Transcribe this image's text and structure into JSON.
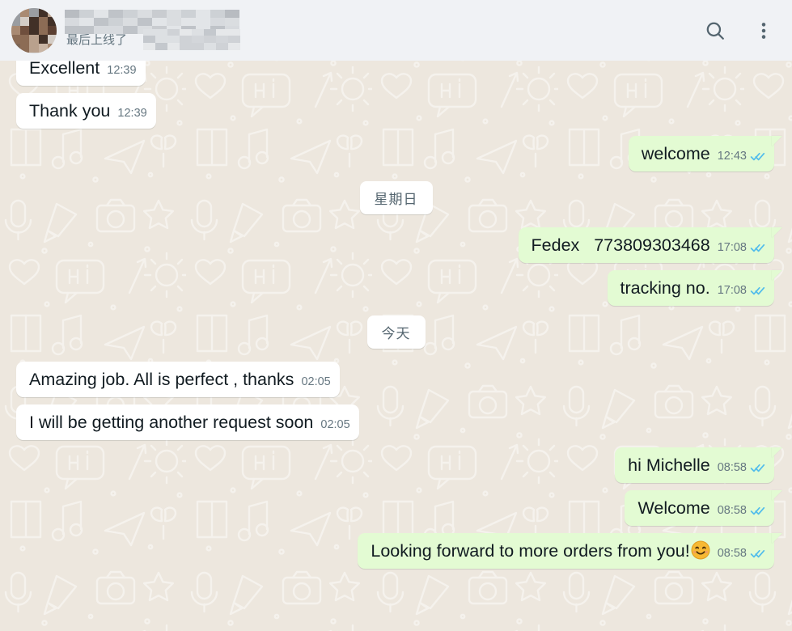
{
  "header": {
    "contact_name": "",
    "contact_name_redacted": true,
    "status_text": "最后上线了",
    "status_redacted": true,
    "avatar_redacted": true,
    "avatar_name": "contact-avatar",
    "search_icon": "search-icon",
    "menu_icon": "overflow-menu-icon"
  },
  "colors": {
    "header_bg": "#F0F2F5",
    "chat_bg": "#EDE7DE",
    "incoming_bubble": "#FFFFFF",
    "outgoing_bubble": "#E3FBD3",
    "tick_read": "#53BDEB",
    "meta_text": "#667781",
    "msg_text": "#111B21",
    "icon": "#54656F"
  },
  "conversation": [
    {
      "kind": "message",
      "direction": "in",
      "text": "Excellent",
      "time": "12:39",
      "status": "none",
      "clipped_top": true
    },
    {
      "kind": "message",
      "direction": "in",
      "text": "Thank you",
      "time": "12:39",
      "status": "none"
    },
    {
      "kind": "message",
      "direction": "out",
      "text": "welcome",
      "time": "12:43",
      "status": "read"
    },
    {
      "kind": "divider",
      "label": "星期日"
    },
    {
      "kind": "message",
      "direction": "out",
      "text": "Fedex   773809303468",
      "time": "17:08",
      "status": "read"
    },
    {
      "kind": "message",
      "direction": "out",
      "text": "tracking no.",
      "time": "17:08",
      "status": "read"
    },
    {
      "kind": "divider",
      "label": "今天"
    },
    {
      "kind": "message",
      "direction": "in",
      "text": "Amazing job. All is perfect , thanks",
      "time": "02:05",
      "status": "none"
    },
    {
      "kind": "message",
      "direction": "in",
      "text": "I will be getting another request soon",
      "time": "02:05",
      "status": "none"
    },
    {
      "kind": "message",
      "direction": "out",
      "text": "hi Michelle",
      "time": "08:58",
      "status": "read"
    },
    {
      "kind": "message",
      "direction": "out",
      "text": "Welcome",
      "time": "08:58",
      "status": "read"
    },
    {
      "kind": "message",
      "direction": "out",
      "text": "Looking forward to more orders from you!",
      "emoji": "😊",
      "emoji_name": "smiling-face-emoji",
      "time": "08:58",
      "status": "read"
    }
  ]
}
